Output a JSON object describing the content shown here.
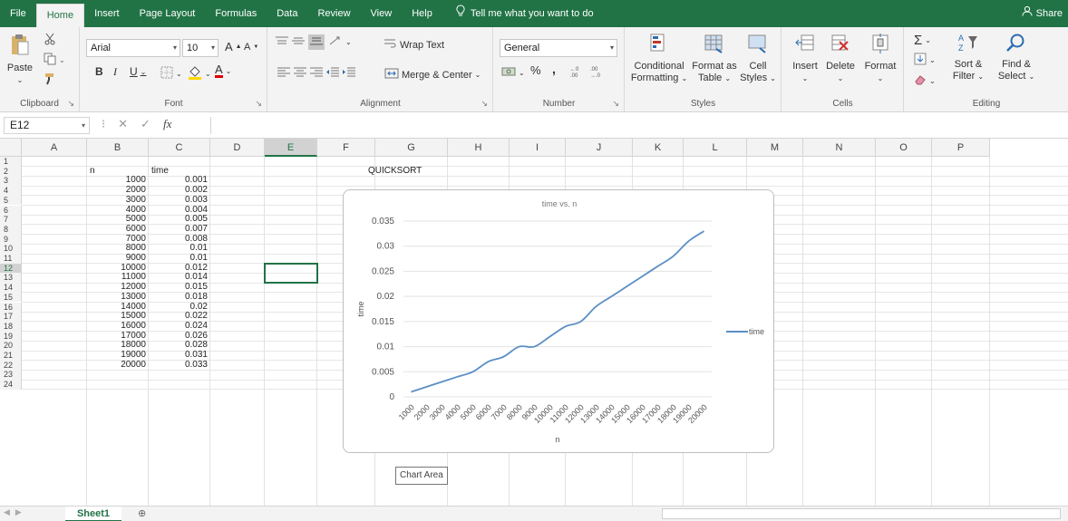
{
  "ribbon_tabs": [
    "File",
    "Home",
    "Insert",
    "Page Layout",
    "Formulas",
    "Data",
    "Review",
    "View",
    "Help"
  ],
  "tell_me": "Tell me what you want to do",
  "share": "Share",
  "clipboard": {
    "paste": "Paste",
    "label": "Clipboard"
  },
  "font": {
    "name": "Arial",
    "size": "10",
    "label": "Font",
    "bold": "B",
    "italic": "I",
    "underline": "U",
    "grow": "A",
    "shrink": "A",
    "color_letter": "A"
  },
  "alignment": {
    "wrap": "Wrap Text",
    "merge": "Merge & Center",
    "label": "Alignment"
  },
  "number": {
    "format": "General",
    "percent": "%",
    "comma": ",",
    "label": "Number"
  },
  "styles": {
    "conditional_1": "Conditional",
    "conditional_2": "Formatting",
    "format_table_1": "Format as",
    "format_table_2": "Table",
    "cell_styles_1": "Cell",
    "cell_styles_2": "Styles",
    "label": "Styles"
  },
  "cells": {
    "insert": "Insert",
    "delete": "Delete",
    "format": "Format",
    "label": "Cells"
  },
  "editing": {
    "sort_1": "Sort &",
    "sort_2": "Filter",
    "find_1": "Find &",
    "find_2": "Select",
    "label": "Editing"
  },
  "formula_bar": {
    "name_box": "E12",
    "fx": "fx",
    "value": ""
  },
  "columns": [
    "A",
    "B",
    "C",
    "D",
    "E",
    "F",
    "G",
    "H",
    "I",
    "J",
    "K",
    "L",
    "M",
    "N",
    "O",
    "P"
  ],
  "rows": [
    "1",
    "2",
    "3",
    "4",
    "5",
    "6",
    "7",
    "8",
    "9",
    "10",
    "11",
    "12",
    "13",
    "14",
    "15",
    "16",
    "17",
    "18",
    "19",
    "20",
    "21",
    "22",
    "23",
    "24"
  ],
  "sheet": {
    "header_n": "n",
    "header_time": "time",
    "title": "QUICKSORT",
    "n": [
      "1000",
      "2000",
      "3000",
      "4000",
      "5000",
      "6000",
      "7000",
      "8000",
      "9000",
      "10000",
      "11000",
      "12000",
      "13000",
      "14000",
      "15000",
      "16000",
      "17000",
      "18000",
      "19000",
      "20000"
    ],
    "time": [
      "0.001",
      "0.002",
      "0.003",
      "0.004",
      "0.005",
      "0.007",
      "0.008",
      "0.01",
      "0.01",
      "0.012",
      "0.014",
      "0.015",
      "0.018",
      "0.02",
      "0.022",
      "0.024",
      "0.026",
      "0.028",
      "0.031",
      "0.033"
    ]
  },
  "chart_data": {
    "type": "line",
    "title": "time vs. n",
    "xlabel": "n",
    "ylabel": "time",
    "ylim": [
      0,
      0.035
    ],
    "yticks": [
      "0",
      "0.005",
      "0.01",
      "0.015",
      "0.02",
      "0.025",
      "0.03",
      "0.035"
    ],
    "categories": [
      "1000",
      "2000",
      "3000",
      "4000",
      "5000",
      "6000",
      "7000",
      "8000",
      "9000",
      "10000",
      "11000",
      "12000",
      "13000",
      "14000",
      "15000",
      "16000",
      "17000",
      "18000",
      "19000",
      "20000"
    ],
    "series": [
      {
        "name": "time",
        "values": [
          0.001,
          0.002,
          0.003,
          0.004,
          0.005,
          0.007,
          0.008,
          0.01,
          0.01,
          0.012,
          0.014,
          0.015,
          0.018,
          0.02,
          0.022,
          0.024,
          0.026,
          0.028,
          0.031,
          0.033
        ]
      }
    ],
    "legend_position": "right",
    "grid": true,
    "color": "#5b8fc4"
  },
  "tooltip": "Chart Area",
  "sheet_tab": "Sheet1",
  "add_sheet": "⊕"
}
